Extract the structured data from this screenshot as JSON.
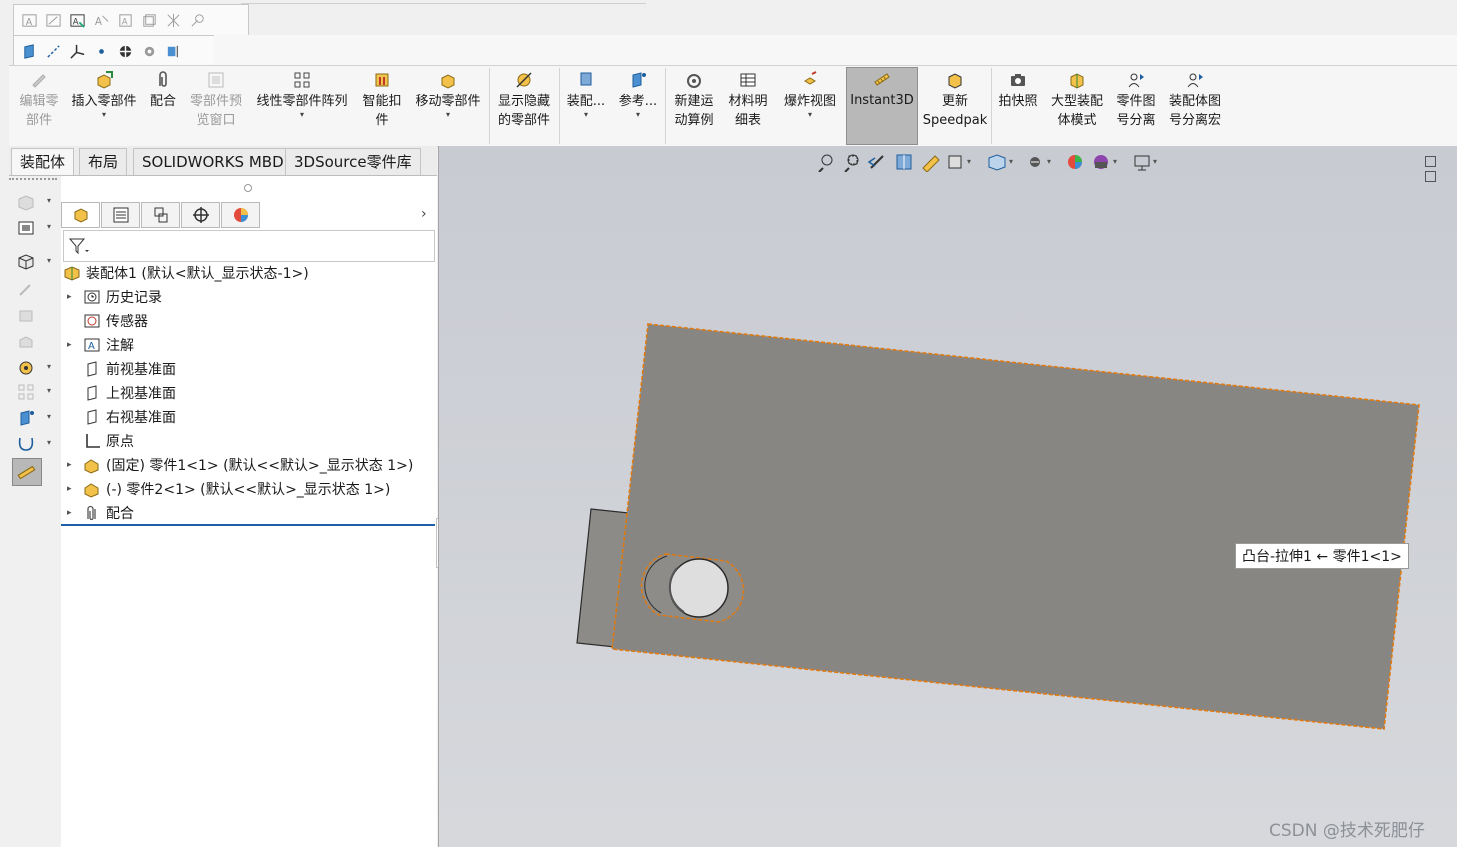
{
  "quick_toolbar_top": {
    "icons": [
      "text-icon",
      "sketch-text-icon",
      "note-icon",
      "balloon-icon",
      "auto-balloon-icon",
      "stack-balloon-icon",
      "weld-symbol-icon",
      "hole-callout-icon"
    ]
  },
  "quick_toolbar_ref": {
    "icons": [
      "plane-icon",
      "axis-icon",
      "coordinate-system-icon",
      "point-icon",
      "center-of-mass-icon",
      "mate-reference-icon",
      "bounding-box-icon"
    ]
  },
  "command_manager": {
    "buttons": [
      {
        "id": "edit-component",
        "label": "编辑零\n部件",
        "disabled": true,
        "dropdown": false
      },
      {
        "id": "insert-component",
        "label": "插入零部件",
        "disabled": false,
        "dropdown": true
      },
      {
        "id": "mate",
        "label": "配合",
        "disabled": false,
        "dropdown": false
      },
      {
        "id": "component-preview",
        "label": "零部件预\n览窗口",
        "disabled": true,
        "dropdown": false
      },
      {
        "id": "linear-pattern",
        "label": "线性零部件阵列",
        "disabled": false,
        "dropdown": true
      },
      {
        "id": "smart-fastener",
        "label": "智能扣\n件",
        "disabled": false,
        "dropdown": false
      },
      {
        "id": "move-component",
        "label": "移动零部件",
        "disabled": false,
        "dropdown": true
      },
      {
        "id": "show-hidden",
        "label": "显示隐藏\n的零部件",
        "disabled": false,
        "dropdown": false
      },
      {
        "id": "assembly-features",
        "label": "装配...",
        "disabled": false,
        "dropdown": true
      },
      {
        "id": "reference-geometry",
        "label": "参考...",
        "disabled": false,
        "dropdown": true
      },
      {
        "id": "new-motion-study",
        "label": "新建运\n动算例",
        "disabled": false,
        "dropdown": false
      },
      {
        "id": "bom",
        "label": "材料明\n细表",
        "disabled": false,
        "dropdown": false
      },
      {
        "id": "exploded-view",
        "label": "爆炸视图",
        "disabled": false,
        "dropdown": true
      },
      {
        "id": "instant3d",
        "label": "Instant3D",
        "disabled": false,
        "dropdown": false
      },
      {
        "id": "update-speedpak",
        "label": "更新\nSpeedpak",
        "disabled": false,
        "dropdown": false
      },
      {
        "id": "snapshot",
        "label": "拍快照",
        "disabled": false,
        "dropdown": false
      },
      {
        "id": "large-assembly",
        "label": "大型装配\n体模式",
        "disabled": false,
        "dropdown": false
      },
      {
        "id": "part-drawing-split",
        "label": "零件图\n号分离",
        "disabled": false,
        "dropdown": false
      },
      {
        "id": "assembly-drawing-split",
        "label": "装配体图\n号分离宏",
        "disabled": false,
        "dropdown": false
      }
    ]
  },
  "tabs": [
    "装配体",
    "布局",
    "SOLIDWORKS MBD",
    "3DSource零件库"
  ],
  "panel_tabs": [
    "feature-manager-icon",
    "property-manager-icon",
    "configuration-manager-icon",
    "dimxpert-icon",
    "display-manager-icon"
  ],
  "tree": {
    "root": "装配体1  (默认<默认_显示状态-1>)",
    "items": [
      {
        "label": "历史记录",
        "expandable": true,
        "icon": "history-icon"
      },
      {
        "label": "传感器",
        "expandable": false,
        "icon": "sensor-icon"
      },
      {
        "label": "注解",
        "expandable": true,
        "icon": "annotation-icon"
      },
      {
        "label": "前视基准面",
        "expandable": false,
        "icon": "plane-icon"
      },
      {
        "label": "上视基准面",
        "expandable": false,
        "icon": "plane-icon"
      },
      {
        "label": "右视基准面",
        "expandable": false,
        "icon": "plane-icon"
      },
      {
        "label": "原点",
        "expandable": false,
        "icon": "origin-icon"
      },
      {
        "label": "(固定) 零件1<1> (默认<<默认>_显示状态 1>)",
        "expandable": true,
        "icon": "part-icon"
      },
      {
        "label": "(-) 零件2<1> (默认<<默认>_显示状态 1>)",
        "expandable": true,
        "icon": "part-icon"
      },
      {
        "label": "配合",
        "expandable": true,
        "icon": "mates-icon"
      }
    ]
  },
  "heads_up_toolbar": {
    "icons": [
      "zoom-to-fit-icon",
      "zoom-to-area-icon",
      "previous-view-icon",
      "section-view-icon",
      "dynamic-annotation-icon",
      "view-orientation-icon",
      "display-style-icon",
      "hide-show-icon",
      "edit-appearance-icon",
      "apply-scene-icon",
      "view-settings-icon"
    ]
  },
  "viewport": {
    "tooltip": "凸台-拉伸1 ← 零件1<1>",
    "watermark": "CSDN @技术死肥仔",
    "plate_color": "#888683",
    "highlight_color": "#e07a10"
  }
}
